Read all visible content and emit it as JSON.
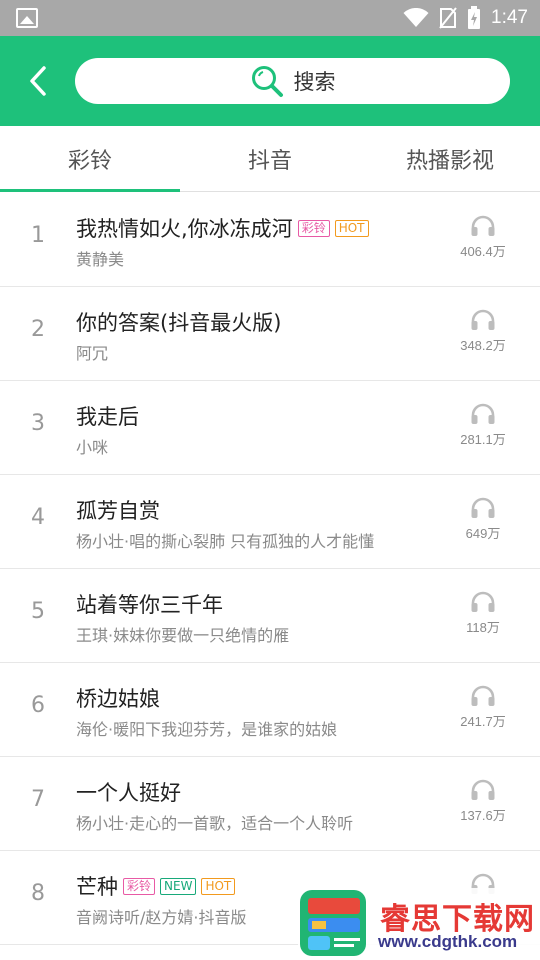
{
  "status_bar": {
    "time": "1:47"
  },
  "header": {
    "search_label": "搜索"
  },
  "tabs": [
    {
      "label": "彩铃",
      "active": true
    },
    {
      "label": "抖音",
      "active": false
    },
    {
      "label": "热播影视",
      "active": false
    }
  ],
  "songs": [
    {
      "rank": "1",
      "title": "我热情如火,你冰冻成河",
      "badges": [
        "彩铃",
        "HOT"
      ],
      "subtitle": "黄静美",
      "plays": "406.4万"
    },
    {
      "rank": "2",
      "title": "你的答案(抖音最火版)",
      "badges": [],
      "subtitle": "阿冗",
      "plays": "348.2万"
    },
    {
      "rank": "3",
      "title": "我走后",
      "badges": [],
      "subtitle": "小咪",
      "plays": "281.1万"
    },
    {
      "rank": "4",
      "title": "孤芳自赏",
      "badges": [],
      "subtitle": "杨小壮·唱的撕心裂肺 只有孤独的人才能懂",
      "plays": "649万"
    },
    {
      "rank": "5",
      "title": "站着等你三千年",
      "badges": [],
      "subtitle": "王琪·妹妹你要做一只绝情的雁",
      "plays": "118万"
    },
    {
      "rank": "6",
      "title": "桥边姑娘",
      "badges": [],
      "subtitle": "海伦·暖阳下我迎芬芳，是谁家的姑娘",
      "plays": "241.7万"
    },
    {
      "rank": "7",
      "title": "一个人挺好",
      "badges": [],
      "subtitle": "杨小壮·走心的一首歌，适合一个人聆听",
      "plays": "137.6万"
    },
    {
      "rank": "8",
      "title": "芒种",
      "badges": [
        "彩铃",
        "NEW",
        "HOT"
      ],
      "subtitle": "音阙诗听/赵方婧·抖音版",
      "plays": ""
    }
  ],
  "watermark": {
    "name": "睿思下载网",
    "url": "www.cdgthk.com"
  },
  "colors": {
    "accent": "#1ec17b",
    "badge_caling": "#e85aa5",
    "badge_hot": "#f29a1e",
    "badge_new": "#18a97a"
  },
  "icons": {
    "back": "chevron-left-icon",
    "search": "magnifier-icon",
    "plays": "headphones-icon"
  }
}
